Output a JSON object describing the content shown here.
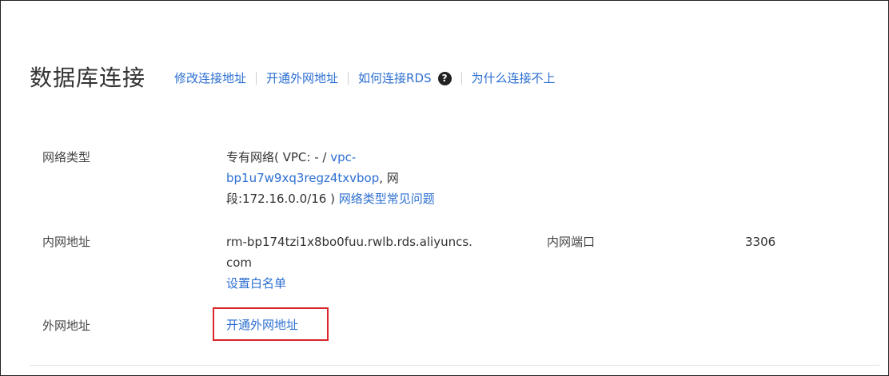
{
  "header": {
    "title": "数据库连接",
    "links": {
      "modify_address": "修改连接地址",
      "open_public": "开通外网地址",
      "how_to_connect": "如何连接RDS",
      "why_fail": "为什么连接不上"
    },
    "help_glyph": "?"
  },
  "network_type": {
    "label": "网络类型",
    "prefix": "专有网络( VPC: - / ",
    "vpc_link_part1": "vpc-",
    "vpc_link_part2": "bp1u7w9xq3regz4txvbop",
    "mid": ", 网",
    "segment": "段:172.16.0.0/16 ) ",
    "faq_link": "网络类型常见问题"
  },
  "internal_address": {
    "label": "内网地址",
    "value_line1": "rm-bp174tzi1x8bo0fuu.rwlb.rds.aliyuncs.",
    "value_line2": "com",
    "whitelist_link": "设置白名单",
    "port_label": "内网端口",
    "port_value": "3306"
  },
  "public_address": {
    "label": "外网地址",
    "open_link": "开通外网地址"
  },
  "colors": {
    "link": "#2c6fd1",
    "highlight": "#d9262b"
  }
}
